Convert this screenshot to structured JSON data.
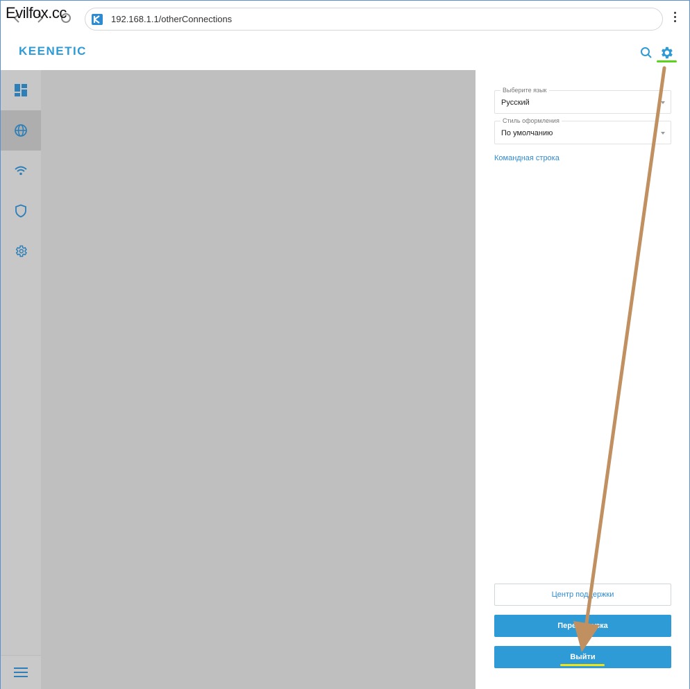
{
  "watermark": "Evilfox.cc",
  "browser": {
    "url": "192.168.1.1/otherConnections"
  },
  "app": {
    "logo": "KEENETIC"
  },
  "sidebar": {
    "items": [
      {
        "icon": "dashboard-icon"
      },
      {
        "icon": "globe-icon",
        "active": true
      },
      {
        "icon": "wifi-icon"
      },
      {
        "icon": "shield-icon"
      },
      {
        "icon": "gear-icon"
      }
    ],
    "bottom_icon": "menu-icon"
  },
  "panel": {
    "language": {
      "label": "Выберите язык",
      "value": "Русский"
    },
    "theme": {
      "label": "Стиль оформления",
      "value": "По умолчанию"
    },
    "cmd_link": "Командная строка",
    "support_button": "Центр поддержки",
    "reboot_button": "Перезагрузка",
    "logout_button": "Выйти"
  },
  "colors": {
    "accent": "#2e9ad6",
    "overlay": "#bfbfbf",
    "annotation_arrow": "#c09060",
    "highlight_green": "#5bd31a",
    "highlight_yellow": "#f0e414"
  }
}
